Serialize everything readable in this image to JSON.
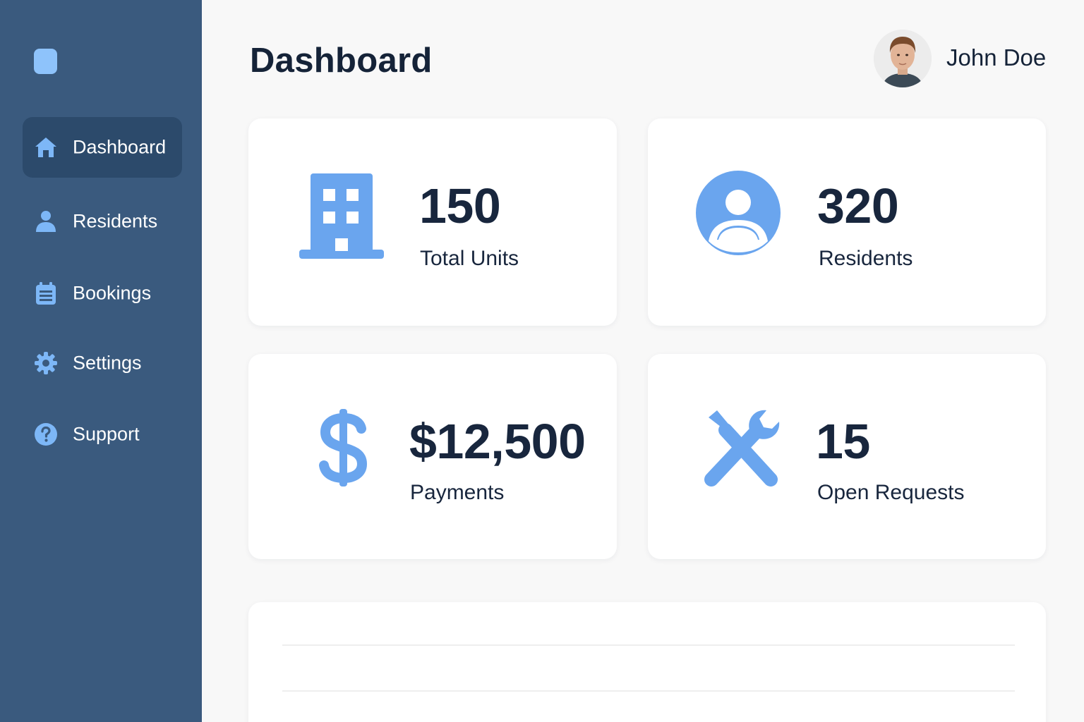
{
  "colors": {
    "sidebar_bg": "#3a5a7e",
    "sidebar_active": "#2c4a6b",
    "accent": "#6aa5ee",
    "text_dark": "#18263d",
    "page_bg": "#f8f8f8"
  },
  "sidebar": {
    "items": [
      {
        "label": "Dashboard",
        "icon": "home-icon",
        "active": true
      },
      {
        "label": "Residents",
        "icon": "person-icon",
        "active": false
      },
      {
        "label": "Bookings",
        "icon": "calendar-icon",
        "active": false
      },
      {
        "label": "Settings",
        "icon": "gear-icon",
        "active": false
      },
      {
        "label": "Support",
        "icon": "help-icon",
        "active": false
      }
    ]
  },
  "header": {
    "title": "Dashboard",
    "user_name": "John Doe"
  },
  "stats": [
    {
      "value": "150",
      "label": "Total Units",
      "icon": "building-icon"
    },
    {
      "value": "320",
      "label": "Residents",
      "icon": "user-circle-icon"
    },
    {
      "value": "$12,500",
      "label": "Payments",
      "icon": "dollar-icon"
    },
    {
      "value": "15",
      "label": "Open Requests",
      "icon": "tools-icon"
    }
  ]
}
